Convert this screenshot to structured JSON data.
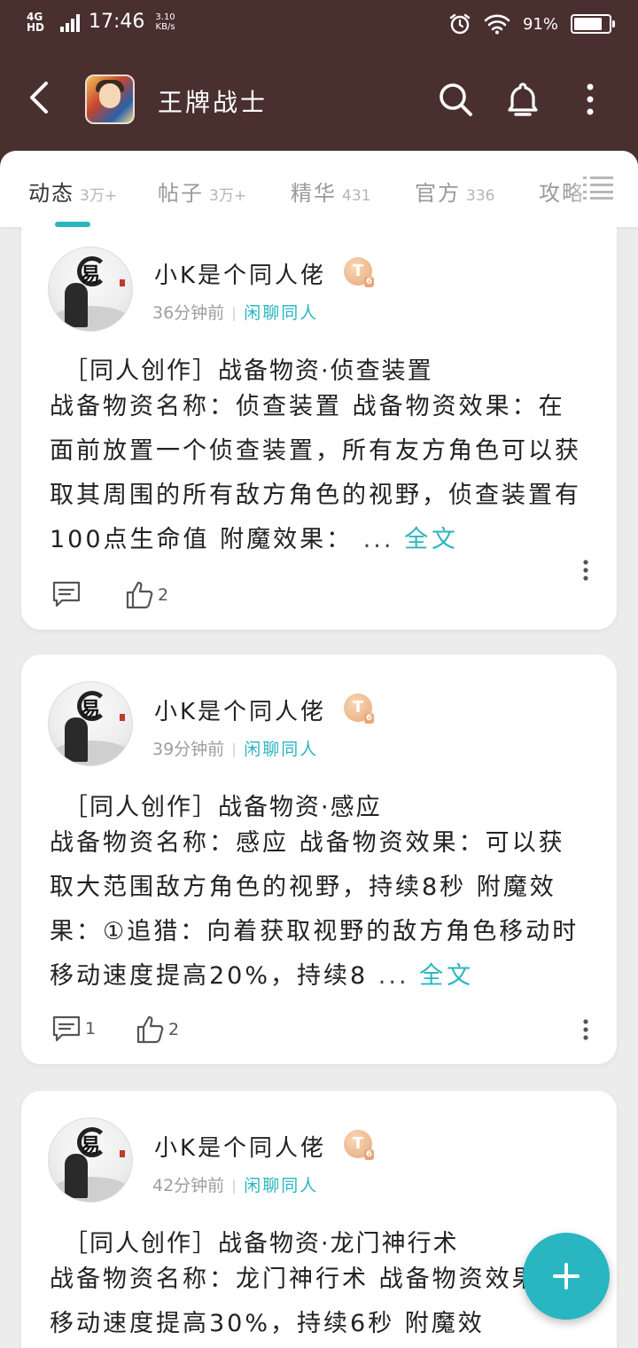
{
  "status_bar": {
    "network": "4G HD",
    "time": "17:46",
    "speed_value": "3.10",
    "speed_unit": "KB/s",
    "battery_percent": "91%",
    "battery_level": 0.91,
    "icons": [
      "signal-icon",
      "alarm-icon",
      "wifi-icon",
      "battery-icon"
    ]
  },
  "header": {
    "title": "王牌战士",
    "icons": [
      "back-arrow-icon",
      "game-logo",
      "search-icon",
      "bell-icon",
      "more-vertical-icon"
    ]
  },
  "tabs": [
    {
      "label": "动态",
      "count": "3万+",
      "active": true
    },
    {
      "label": "帖子",
      "count": "3万+",
      "active": false
    },
    {
      "label": "精华",
      "count": "431",
      "active": false
    },
    {
      "label": "官方",
      "count": "336",
      "active": false
    },
    {
      "label": "攻略",
      "count": "",
      "active": false
    }
  ],
  "posts": [
    {
      "username": "小K是个同人佬",
      "level": "T",
      "level_sub": "6",
      "time": "36分钟前",
      "category": "闲聊同人",
      "title": "［同人创作］战备物资·侦查装置",
      "body": "战备物资名称：侦查装置 战备物资效果：在面前放置一个侦查装置，所有友方角色可以获取其周围的所有敌方角色的视野，侦查装置有100点生命值 附魔效果：",
      "ellipsis": "...",
      "read_more": "全文",
      "comments": "",
      "likes": "2"
    },
    {
      "username": "小K是个同人佬",
      "level": "T",
      "level_sub": "6",
      "time": "39分钟前",
      "category": "闲聊同人",
      "title": "［同人创作］战备物资·感应",
      "body": "战备物资名称：感应 战备物资效果：可以获取大范围敌方角色的视野，持续8秒 附魔效果：①追猎：向着获取视野的敌方角色移动时移动速度提高20%，持续8",
      "ellipsis": "...",
      "read_more": "全文",
      "comments": "1",
      "likes": "2"
    },
    {
      "username": "小K是个同人佬",
      "level": "T",
      "level_sub": "6",
      "time": "42分钟前",
      "category": "闲聊同人",
      "title": "［同人创作］战备物资·龙门神行术",
      "body": "战备物资名称：龙门神行术 战备物资效果：移动速度提高30%，持续6秒 附魔效",
      "ellipsis": "",
      "read_more": "",
      "comments": "",
      "likes": ""
    }
  ],
  "fab": {
    "icon": "plus-icon"
  },
  "colors": {
    "header_bg": "#4a2f2f",
    "accent": "#29b6c0",
    "page_bg": "#ececec"
  }
}
